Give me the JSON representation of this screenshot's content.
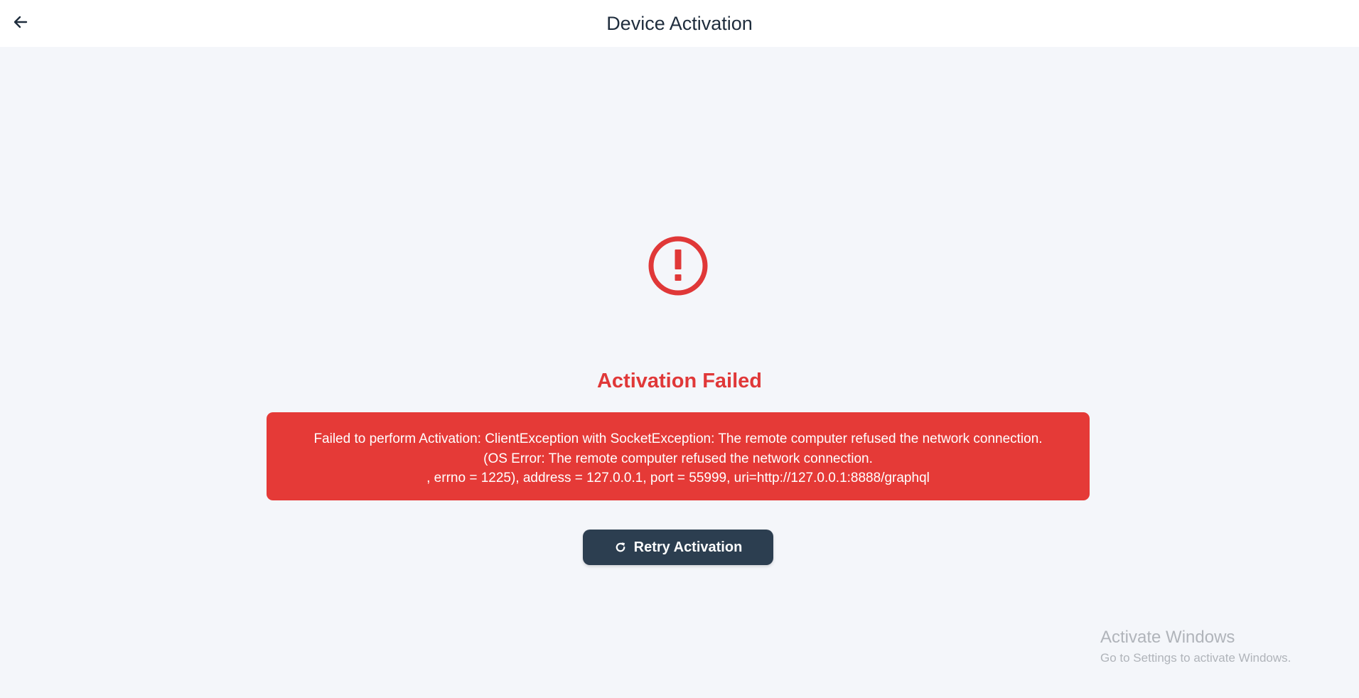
{
  "header": {
    "title": "Device Activation",
    "back_icon": "arrow-left-icon"
  },
  "status": {
    "icon": "error-exclamation-icon",
    "title": "Activation Failed",
    "color": "#e03838"
  },
  "error": {
    "lines": [
      "Failed to perform Activation: ClientException with SocketException: The remote computer refused the network connection.",
      "(OS Error: The remote computer refused the network connection.",
      ", errno = 1225), address = 127.0.0.1, port = 55999, uri=http://127.0.0.1:8888/graphql"
    ],
    "background": "#e53a37"
  },
  "actions": {
    "retry_label": "Retry Activation",
    "retry_icon": "refresh-icon",
    "retry_background": "#2c3e50"
  },
  "watermark": {
    "title": "Activate Windows",
    "subtitle": "Go to Settings to activate Windows."
  }
}
